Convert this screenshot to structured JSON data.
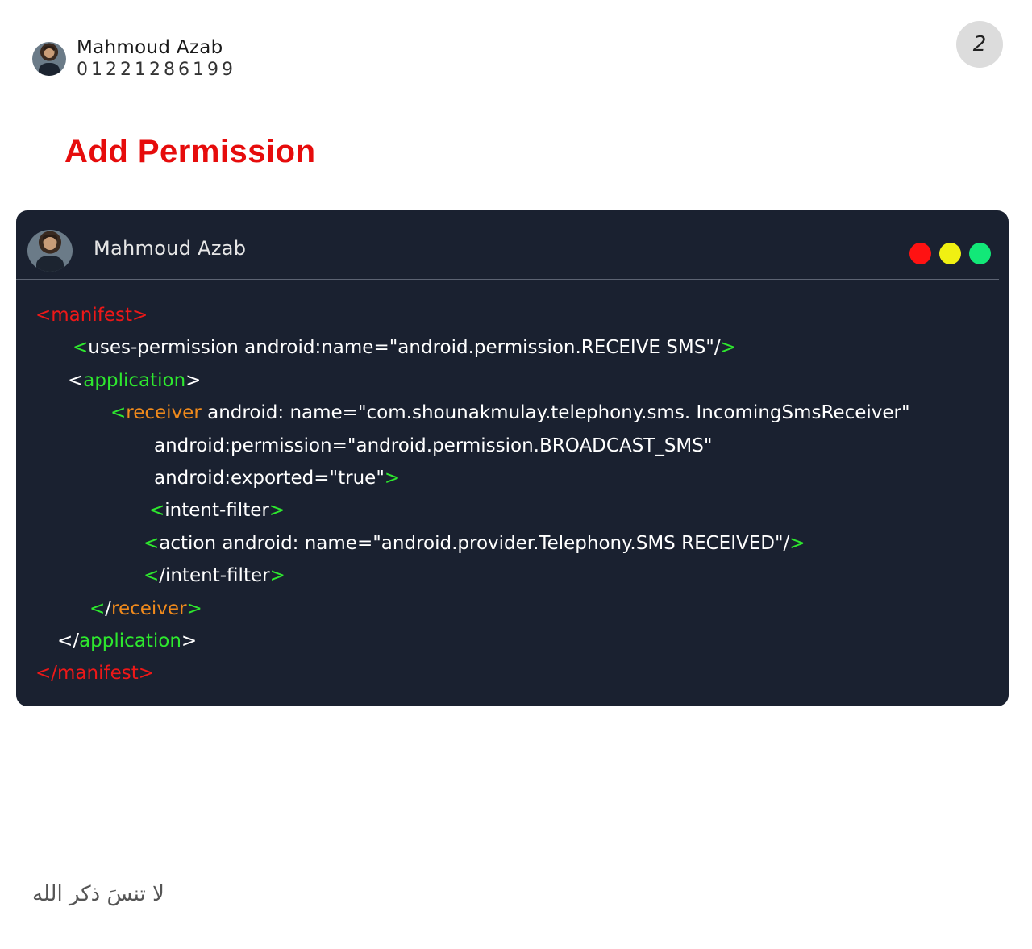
{
  "author": {
    "name": "Mahmoud Azab",
    "phone": "01221286199"
  },
  "page_number": "2",
  "title": "Add Permission",
  "card": {
    "name": "Mahmoud Azab",
    "window_dots": [
      "#ff1212",
      "#f0f012",
      "#12e878"
    ]
  },
  "code": {
    "l1": {
      "open": "<manifest>"
    },
    "l2": {
      "lt": "<",
      "text": "uses-permission android:name=\"android.permission.RECEIVE SMS\"/",
      "gt": ">"
    },
    "l3": {
      "lt": "<",
      "tag": "application",
      "gt": ">"
    },
    "l4": {
      "lt": "<",
      "tag": "receiver",
      "text": " android: name=\"com.shounakmulay.telephony.sms. IncomingSmsReceiver\""
    },
    "l5": {
      "text": "android:permission=\"android.permission.BROADCAST_SMS\""
    },
    "l6": {
      "text": "android:exported=\"true\"",
      "gt": ">"
    },
    "l7": {
      "lt": "<",
      "tag": "intent-filter",
      "gt": ">"
    },
    "l8": {
      "lt": "<",
      "text": "action android: name=\"android.provider.Telephony.SMS RECEIVED\"/",
      "gt": ">"
    },
    "l9": {
      "lt": "<",
      "slash": "/",
      "tag": "intent-filter",
      "gt": ">"
    },
    "l10": {
      "lt": "<",
      "slash": "/",
      "tag": "receiver",
      "gt": ">"
    },
    "l11": {
      "lt": "<",
      "slash": "/",
      "tag": "application",
      "gt": ">"
    },
    "l12": {
      "close": "</manifest>"
    }
  },
  "footer": "لا تنسَ ذكر الله"
}
